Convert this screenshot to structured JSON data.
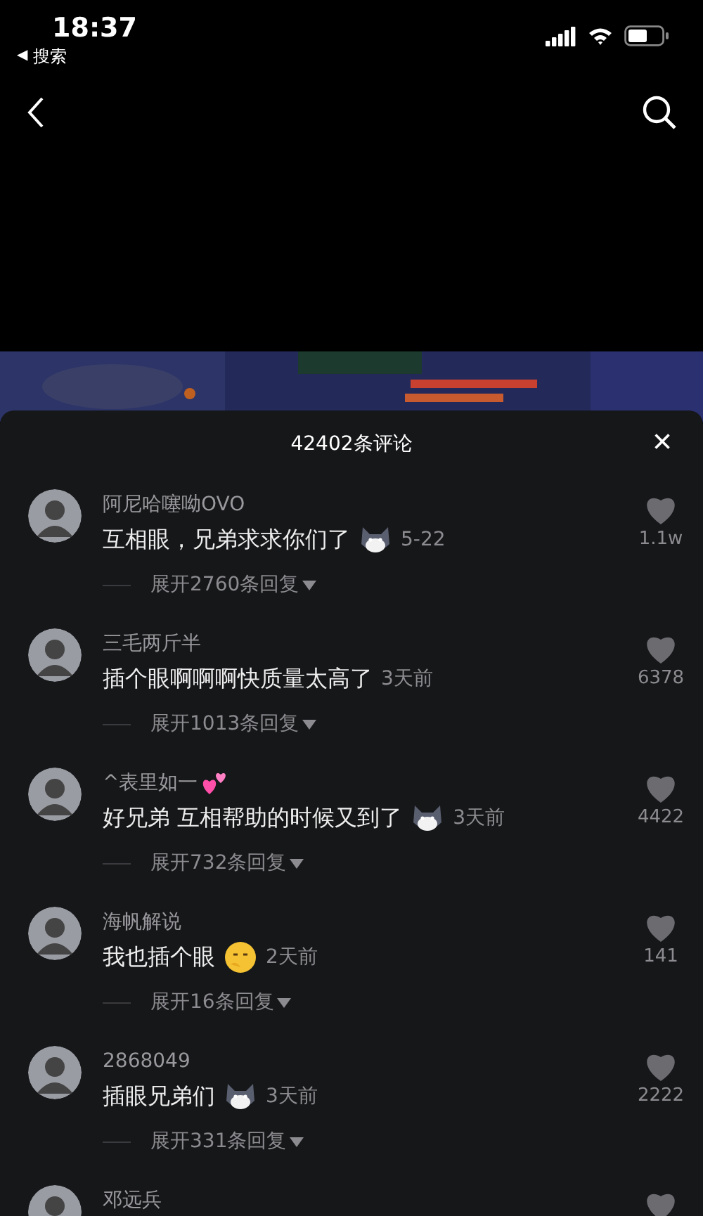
{
  "status_bar": {
    "time": "18:37",
    "back_arrow": "◀",
    "back_label": "搜索"
  },
  "comments_sheet": {
    "title": "42402条评论",
    "close": "×"
  },
  "comments": [
    {
      "name": "阿尼哈噻呦OVO",
      "text": "互相眼，兄弟求求你们了",
      "sticker": {
        "kind": "cat"
      },
      "time": "5-22",
      "likes": "1.1w",
      "replies": "展开2760条回复"
    },
    {
      "name": "三毛两斤半",
      "text": "插个眼啊啊啊快质量太高了",
      "time": "3天前",
      "likes": "6378",
      "replies": "展开1013条回复"
    },
    {
      "name": "^表里如一",
      "name_sticker": {
        "kind": "hearts"
      },
      "text": "好兄弟 互相帮助的时候又到了",
      "sticker": {
        "kind": "cat"
      },
      "time": "3天前",
      "likes": "4422",
      "replies": "展开732条回复"
    },
    {
      "name": "海帆解说",
      "text": "我也插个眼",
      "sticker": {
        "kind": "face"
      },
      "time": "2天前",
      "likes": "141",
      "replies": "展开16条回复"
    },
    {
      "name": "2868049",
      "text": "插眼兄弟们",
      "sticker": {
        "kind": "cat"
      },
      "time": "3天前",
      "likes": "2222",
      "replies": "展开331条回复"
    },
    {
      "name": "邓远兵"
    }
  ]
}
